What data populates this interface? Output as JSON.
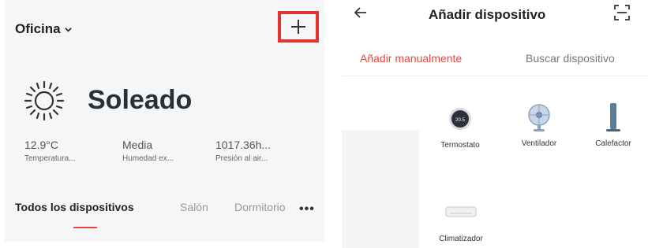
{
  "home": {
    "title": "Oficina",
    "weather": "Soleado",
    "stats": [
      {
        "value": "12.9°C",
        "label": "Temperatura..."
      },
      {
        "value": "Media",
        "label": "Humedad ex..."
      },
      {
        "value": "1017.36h...",
        "label": "Presión al air..."
      }
    ],
    "tabs": [
      "Todos los dispositivos",
      "Salón",
      "Dormitorio"
    ],
    "accent": "#e8473f",
    "highlight": "#e0342f"
  },
  "add_device": {
    "title": "Añadir dispositivo",
    "tabs": {
      "manual": "Añadir manualmente",
      "search": "Buscar dispositivo"
    },
    "thermostat_reading": "20.5",
    "devices": [
      "Termostato",
      "Ventilador",
      "Calefactor",
      "Climatizador"
    ]
  }
}
